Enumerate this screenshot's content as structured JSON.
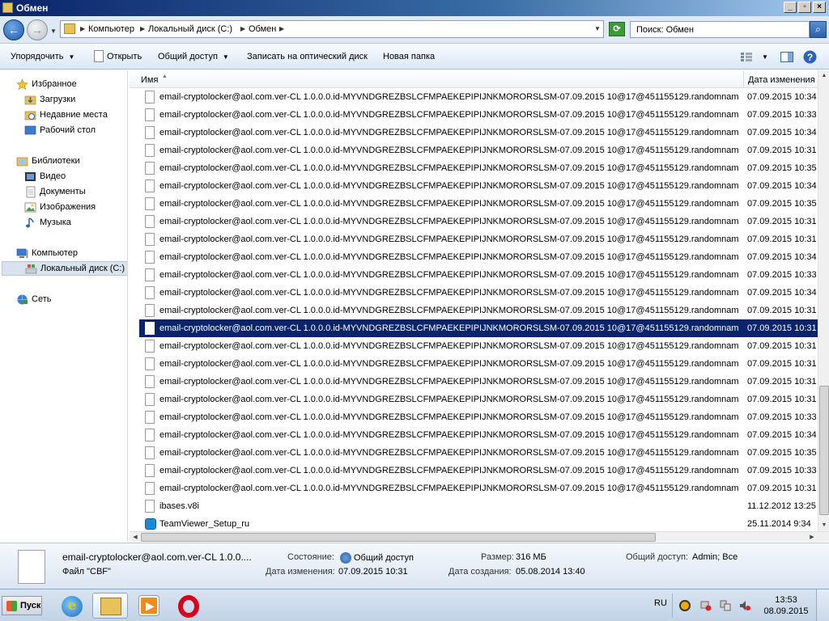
{
  "window": {
    "title": "Обмен",
    "controls": {
      "minimize": "_",
      "maximize": "▫",
      "close": "×"
    }
  },
  "address": {
    "crumbs": [
      "Компьютер",
      "Локальный диск (C:)",
      "Обмен"
    ],
    "search_placeholder": "Поиск: Обмен"
  },
  "toolbar": {
    "organize": "Упорядочить",
    "open": "Открыть",
    "share": "Общий доступ",
    "burn": "Записать на оптический диск",
    "new_folder": "Новая папка"
  },
  "sidebar": {
    "favorites": "Избранное",
    "downloads": "Загрузки",
    "recent": "Недавние места",
    "desktop": "Рабочий стол",
    "libraries": "Библиотеки",
    "video": "Видео",
    "documents": "Документы",
    "images": "Изображения",
    "music": "Музыка",
    "computer": "Компьютер",
    "local_disk": "Локальный диск (C:)",
    "network": "Сеть"
  },
  "columns": {
    "name": "Имя",
    "date": "Дата изменения"
  },
  "files": [
    {
      "name": "email-cryptolocker@aol.com.ver-CL 1.0.0.0.id-MYVNDGREZBSLCFMPAEKEPIPIJNKMORORSLSM-07.09.2015 10@17@451155129.randomname-AN...",
      "date": "07.09.2015 10:34"
    },
    {
      "name": "email-cryptolocker@aol.com.ver-CL 1.0.0.0.id-MYVNDGREZBSLCFMPAEKEPIPIJNKMORORSLSM-07.09.2015 10@17@451155129.randomname-DIL...",
      "date": "07.09.2015 10:33"
    },
    {
      "name": "email-cryptolocker@aol.com.ver-CL 1.0.0.0.id-MYVNDGREZBSLCFMPAEKEPIPIJNKMORORSLSM-07.09.2015 10@17@451155129.randomname-DP...",
      "date": "07.09.2015 10:34"
    },
    {
      "name": "email-cryptolocker@aol.com.ver-CL 1.0.0.0.id-MYVNDGREZBSLCFMPAEKEPIPIJNKMORORSLSM-07.09.2015 10@17@451155129.randomname-FZ...",
      "date": "07.09.2015 10:31"
    },
    {
      "name": "email-cryptolocker@aol.com.ver-CL 1.0.0.0.id-MYVNDGREZBSLCFMPAEKEPIPIJNKMORORSLSM-07.09.2015 10@17@451155129.randomname-GJ...",
      "date": "07.09.2015 10:35"
    },
    {
      "name": "email-cryptolocker@aol.com.ver-CL 1.0.0.0.id-MYVNDGREZBSLCFMPAEKEPIPIJNKMORORSLSM-07.09.2015 10@17@451155129.randomname-GY...",
      "date": "07.09.2015 10:34"
    },
    {
      "name": "email-cryptolocker@aol.com.ver-CL 1.0.0.0.id-MYVNDGREZBSLCFMPAEKEPIPIJNKMORORSLSM-07.09.2015 10@17@451155129.randomname-IUV...",
      "date": "07.09.2015 10:35"
    },
    {
      "name": "email-cryptolocker@aol.com.ver-CL 1.0.0.0.id-MYVNDGREZBSLCFMPAEKEPIPIJNKMORORSLSM-07.09.2015 10@17@451155129.randomname-LM...",
      "date": "07.09.2015 10:31"
    },
    {
      "name": "email-cryptolocker@aol.com.ver-CL 1.0.0.0.id-MYVNDGREZBSLCFMPAEKEPIPIJNKMORORSLSM-07.09.2015 10@17@451155129.randomname-LSV...",
      "date": "07.09.2015 10:31"
    },
    {
      "name": "email-cryptolocker@aol.com.ver-CL 1.0.0.0.id-MYVNDGREZBSLCFMPAEKEPIPIJNKMORORSLSM-07.09.2015 10@17@451155129.randomname-OO...",
      "date": "07.09.2015 10:34"
    },
    {
      "name": "email-cryptolocker@aol.com.ver-CL 1.0.0.0.id-MYVNDGREZBSLCFMPAEKEPIPIJNKMORORSLSM-07.09.2015 10@17@451155129.randomname-OP...",
      "date": "07.09.2015 10:33"
    },
    {
      "name": "email-cryptolocker@aol.com.ver-CL 1.0.0.0.id-MYVNDGREZBSLCFMPAEKEPIPIJNKMORORSLSM-07.09.2015 10@17@451155129.randomname-QB...",
      "date": "07.09.2015 10:34"
    },
    {
      "name": "email-cryptolocker@aol.com.ver-CL 1.0.0.0.id-MYVNDGREZBSLCFMPAEKEPIPIJNKMORORSLSM-07.09.2015 10@17@451155129.randomname-QN...",
      "date": "07.09.2015 10:31"
    },
    {
      "name": "email-cryptolocker@aol.com.ver-CL 1.0.0.0.id-MYVNDGREZBSLCFMPAEKEPIPIJNKMORORSLSM-07.09.2015 10@17@451155129.randomname-SO...",
      "date": "07.09.2015 10:31",
      "selected": true
    },
    {
      "name": "email-cryptolocker@aol.com.ver-CL 1.0.0.0.id-MYVNDGREZBSLCFMPAEKEPIPIJNKMORORSLSM-07.09.2015 10@17@451155129.randomname-SS...",
      "date": "07.09.2015 10:31"
    },
    {
      "name": "email-cryptolocker@aol.com.ver-CL 1.0.0.0.id-MYVNDGREZBSLCFMPAEKEPIPIJNKMORORSLSM-07.09.2015 10@17@451155129.randomname-TR...",
      "date": "07.09.2015 10:31"
    },
    {
      "name": "email-cryptolocker@aol.com.ver-CL 1.0.0.0.id-MYVNDGREZBSLCFMPAEKEPIPIJNKMORORSLSM-07.09.2015 10@17@451155129.randomname-UI...",
      "date": "07.09.2015 10:31"
    },
    {
      "name": "email-cryptolocker@aol.com.ver-CL 1.0.0.0.id-MYVNDGREZBSLCFMPAEKEPIPIJNKMORORSLSM-07.09.2015 10@17@451155129.randomname-WL...",
      "date": "07.09.2015 10:31"
    },
    {
      "name": "email-cryptolocker@aol.com.ver-CL 1.0.0.0.id-MYVNDGREZBSLCFMPAEKEPIPIJNKMORORSLSM-07.09.2015 10@17@451155129.randomname-XE...",
      "date": "07.09.2015 10:33"
    },
    {
      "name": "email-cryptolocker@aol.com.ver-CL 1.0.0.0.id-MYVNDGREZBSLCFMPAEKEPIPIJNKMORORSLSM-07.09.2015 10@17@451155129.randomname-YW...",
      "date": "07.09.2015 10:34"
    },
    {
      "name": "email-cryptolocker@aol.com.ver-CL 1.0.0.0.id-MYVNDGREZBSLCFMPAEKEPIPIJNKMORORSLSM-07.09.2015 10@17@451155129.randomname-ZLI...",
      "date": "07.09.2015 10:35"
    },
    {
      "name": "email-cryptolocker@aol.com.ver-CL 1.0.0.0.id-MYVNDGREZBSLCFMPAEKEPIPIJNKMORORSLSM-07.09.2015 10@17@451155129.randomname-ZO...",
      "date": "07.09.2015 10:33"
    },
    {
      "name": "email-cryptolocker@aol.com.ver-CL 1.0.0.0.id-MYVNDGREZBSLCFMPAEKEPIPIJNKMORORSLSM-07.09.2015 10@17@451155129.randomname-ZW...",
      "date": "07.09.2015 10:31"
    },
    {
      "name": "ibases.v8i",
      "date": "11.12.2012 13:25"
    },
    {
      "name": "TeamViewer_Setup_ru",
      "date": "25.11.2014 9:34",
      "icon": "teamviewer"
    }
  ],
  "details": {
    "filename": "email-cryptolocker@aol.com.ver-CL 1.0.0....",
    "filetype": "Файл \"CBF\"",
    "state_label": "Состояние:",
    "state_value": "Общий доступ",
    "modified_label": "Дата изменения:",
    "modified_value": "07.09.2015 10:31",
    "size_label": "Размер:",
    "size_value": "316 МБ",
    "created_label": "Дата создания:",
    "created_value": "05.08.2014 13:40",
    "share_label": "Общий доступ:",
    "share_value": "Admin; Все"
  },
  "taskbar": {
    "start": "Пуск",
    "lang": "RU",
    "time": "13:53",
    "date": "08.09.2015"
  }
}
